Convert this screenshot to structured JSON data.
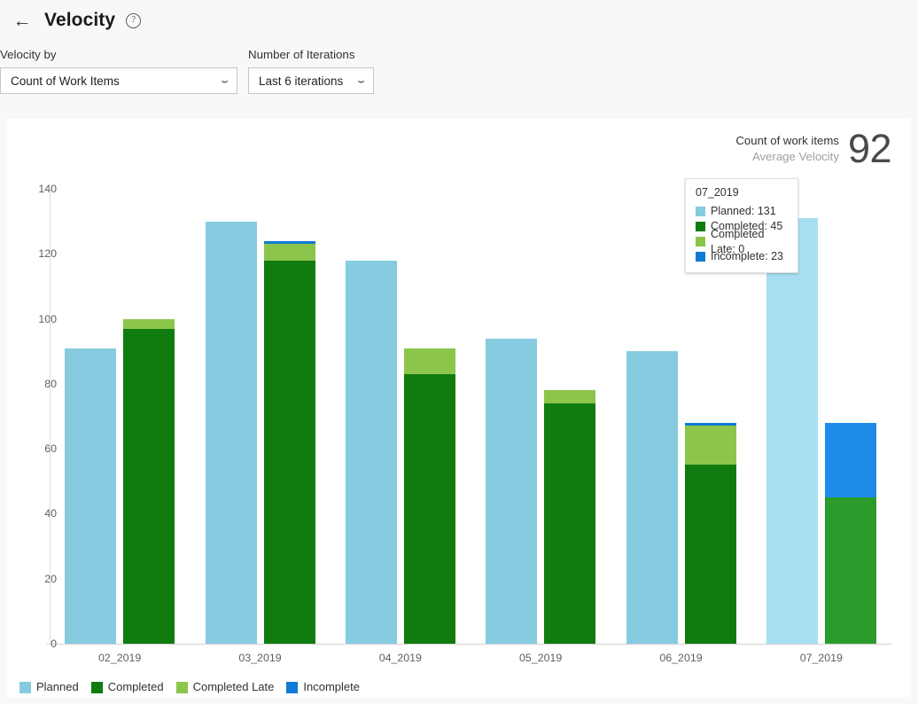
{
  "header": {
    "back_icon": "←",
    "title": "Velocity",
    "help_icon": "?"
  },
  "filters": [
    {
      "label": "Velocity by",
      "value": "Count of Work Items",
      "chevron": "⌄"
    },
    {
      "label": "Number of Iterations",
      "value": "Last 6 iterations",
      "chevron": "⌄"
    }
  ],
  "summary": {
    "line1": "Count of work items",
    "line2": "Average Velocity",
    "value": "92"
  },
  "tooltip": {
    "title": "07_2019",
    "rows": [
      {
        "label": "Planned: 131",
        "color": "#86cbe0"
      },
      {
        "label": "Completed: 45",
        "color": "#107c10"
      },
      {
        "label": "Completed Late: 0",
        "color": "#8cc54b"
      },
      {
        "label": "Incomplete: 23",
        "color": "#0f7bd4"
      }
    ]
  },
  "legend": [
    {
      "label": "Planned",
      "color": "#86cbe0"
    },
    {
      "label": "Completed",
      "color": "#107c10"
    },
    {
      "label": "Completed Late",
      "color": "#8cc54b"
    },
    {
      "label": "Incomplete",
      "color": "#0f7bd4"
    }
  ],
  "chart_data": {
    "type": "bar",
    "title": "Velocity",
    "subtitle": "Count of work items",
    "xlabel": "",
    "ylabel": "",
    "ylim": [
      0,
      140
    ],
    "yticks": [
      0,
      20,
      40,
      60,
      80,
      100,
      120,
      140
    ],
    "grid": false,
    "legend_position": "bottom-left",
    "stacked": true,
    "highlighted_category": "07_2019",
    "categories": [
      "02_2019",
      "03_2019",
      "04_2019",
      "05_2019",
      "06_2019",
      "07_2019"
    ],
    "series": [
      {
        "name": "Planned",
        "color": "#86cbe0",
        "highlight_color": "#a7dff2",
        "values": [
          91,
          130,
          118,
          94,
          90,
          131
        ]
      },
      {
        "name": "Completed",
        "color": "#107c10",
        "highlight_color": "#2b9b2b",
        "values": [
          97,
          118,
          83,
          74,
          55,
          45
        ]
      },
      {
        "name": "Completed Late",
        "color": "#8cc54b",
        "highlight_color": "#9ed45f",
        "values": [
          3,
          5,
          8,
          4,
          12,
          0
        ]
      },
      {
        "name": "Incomplete",
        "color": "#0f7bd4",
        "highlight_color": "#1e8be8",
        "values": [
          0,
          1,
          0,
          0,
          1,
          23
        ]
      }
    ]
  }
}
